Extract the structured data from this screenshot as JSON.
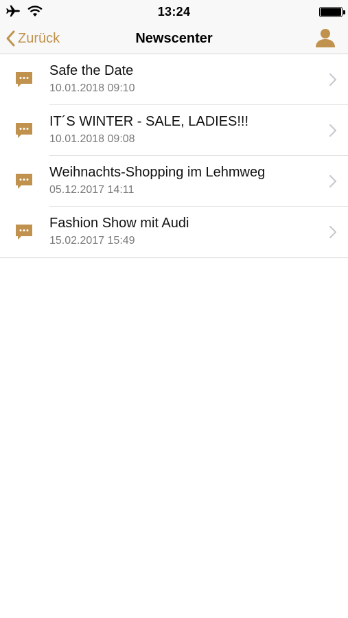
{
  "status_bar": {
    "time": "13:24",
    "icons": [
      "airplane-icon",
      "wifi-icon",
      "battery-icon"
    ]
  },
  "nav": {
    "back_label": "Zurück",
    "title": "Newscenter",
    "profile_icon": "person-icon"
  },
  "colors": {
    "accent": "#c0924e",
    "secondary_text": "#7a7a7a",
    "nav_background": "#f8f8f8"
  },
  "news": [
    {
      "title": "Safe the Date",
      "date": "10.01.2018 09:10"
    },
    {
      "title": "IT´S WINTER - SALE, LADIES!!!",
      "date": "10.01.2018 09:08"
    },
    {
      "title": "Weihnachts-Shopping im Lehmweg",
      "date": "05.12.2017 14:11"
    },
    {
      "title": "Fashion Show mit Audi",
      "date": "15.02.2017 15:49"
    }
  ]
}
